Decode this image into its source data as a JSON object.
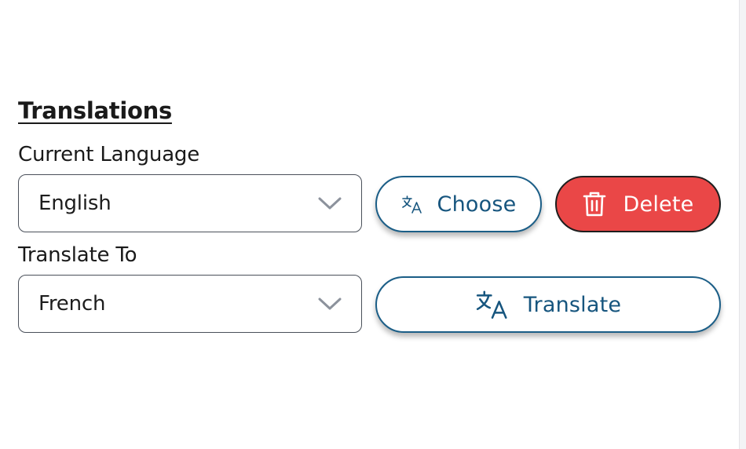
{
  "section": {
    "title": "Translations"
  },
  "current_language": {
    "label": "Current Language",
    "value": "English",
    "choose_label": "Choose",
    "delete_label": "Delete"
  },
  "translate_to": {
    "label": "Translate To",
    "value": "French",
    "translate_label": "Translate"
  },
  "colors": {
    "accent": "#16557e",
    "danger": "#ea4747",
    "border": "#4a505a",
    "chevron": "#8c929c"
  },
  "icons": {
    "choose": "translate-icon",
    "delete": "trash-icon",
    "translate": "translate-icon",
    "select": "chevron-down-icon"
  }
}
